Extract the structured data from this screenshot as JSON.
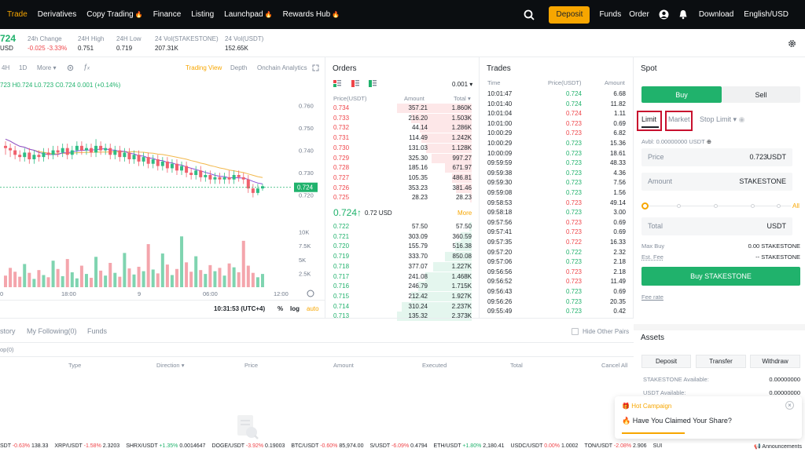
{
  "nav": {
    "items": [
      "Trade",
      "Derivatives",
      "Copy Trading",
      "Finance",
      "Listing",
      "Launchpad",
      "Rewards Hub"
    ],
    "deposit": "Deposit",
    "funds": "Funds",
    "order": "Order",
    "download": "Download",
    "lang": "English/USD"
  },
  "ticker": {
    "price": "724",
    "usd": "USD",
    "change_label": "24h Change",
    "change_value": "-0.025 -3.33%",
    "high_label": "24H High",
    "high_value": "0.751",
    "low_label": "24H Low",
    "low_value": "0.719",
    "vol1_label": "24 Vol(STAKESTONE)",
    "vol1_value": "207.31K",
    "vol2_label": "24 Vol(USDT)",
    "vol2_value": "152.65K"
  },
  "chart": {
    "intervals": [
      "4H",
      "1D",
      "More"
    ],
    "views": [
      "Trading View",
      "Depth",
      "Onchain Analytics"
    ],
    "ohlc": "723 H0.724 L0.723 C0.724 0.001 (+0.14%)",
    "y_ticks": [
      "0.760",
      "0.750",
      "0.740",
      "0.730",
      "0.720"
    ],
    "current_price_tag": "0.724",
    "vol_ticks": [
      "10K",
      "7.5K",
      "5K",
      "2.5K"
    ],
    "x_ticks": [
      "0",
      "18:00",
      "9",
      "06:00",
      "12:00"
    ],
    "time": "10:31:53 (UTC+4)",
    "percent": "%",
    "log": "log",
    "auto": "auto",
    "candles": [
      {
        "o": 0.742,
        "c": 0.741,
        "h": 0.744,
        "l": 0.738
      },
      {
        "o": 0.741,
        "c": 0.74,
        "h": 0.743,
        "l": 0.737
      },
      {
        "o": 0.74,
        "c": 0.738,
        "h": 0.742,
        "l": 0.736
      },
      {
        "o": 0.738,
        "c": 0.737,
        "h": 0.74,
        "l": 0.735
      },
      {
        "o": 0.737,
        "c": 0.739,
        "h": 0.741,
        "l": 0.735
      },
      {
        "o": 0.739,
        "c": 0.736,
        "h": 0.741,
        "l": 0.734
      },
      {
        "o": 0.736,
        "c": 0.738,
        "h": 0.74,
        "l": 0.734
      },
      {
        "o": 0.738,
        "c": 0.737,
        "h": 0.74,
        "l": 0.735
      },
      {
        "o": 0.737,
        "c": 0.739,
        "h": 0.741,
        "l": 0.735
      },
      {
        "o": 0.739,
        "c": 0.738,
        "h": 0.741,
        "l": 0.736
      },
      {
        "o": 0.738,
        "c": 0.74,
        "h": 0.742,
        "l": 0.736
      },
      {
        "o": 0.74,
        "c": 0.739,
        "h": 0.742,
        "l": 0.737
      },
      {
        "o": 0.739,
        "c": 0.741,
        "h": 0.743,
        "l": 0.737
      },
      {
        "o": 0.741,
        "c": 0.738,
        "h": 0.743,
        "l": 0.736
      },
      {
        "o": 0.738,
        "c": 0.74,
        "h": 0.742,
        "l": 0.736
      },
      {
        "o": 0.74,
        "c": 0.742,
        "h": 0.744,
        "l": 0.738
      },
      {
        "o": 0.742,
        "c": 0.74,
        "h": 0.744,
        "l": 0.738
      },
      {
        "o": 0.74,
        "c": 0.741,
        "h": 0.743,
        "l": 0.738
      },
      {
        "o": 0.741,
        "c": 0.739,
        "h": 0.743,
        "l": 0.737
      },
      {
        "o": 0.739,
        "c": 0.742,
        "h": 0.745,
        "l": 0.737
      },
      {
        "o": 0.742,
        "c": 0.74,
        "h": 0.744,
        "l": 0.738
      },
      {
        "o": 0.74,
        "c": 0.741,
        "h": 0.743,
        "l": 0.738
      },
      {
        "o": 0.741,
        "c": 0.738,
        "h": 0.743,
        "l": 0.736
      },
      {
        "o": 0.738,
        "c": 0.74,
        "h": 0.742,
        "l": 0.736
      },
      {
        "o": 0.74,
        "c": 0.737,
        "h": 0.742,
        "l": 0.735
      },
      {
        "o": 0.737,
        "c": 0.739,
        "h": 0.741,
        "l": 0.735
      },
      {
        "o": 0.739,
        "c": 0.736,
        "h": 0.741,
        "l": 0.734
      },
      {
        "o": 0.736,
        "c": 0.738,
        "h": 0.74,
        "l": 0.734
      },
      {
        "o": 0.738,
        "c": 0.735,
        "h": 0.74,
        "l": 0.733
      },
      {
        "o": 0.735,
        "c": 0.737,
        "h": 0.739,
        "l": 0.733
      },
      {
        "o": 0.737,
        "c": 0.734,
        "h": 0.739,
        "l": 0.732
      },
      {
        "o": 0.734,
        "c": 0.736,
        "h": 0.738,
        "l": 0.732
      },
      {
        "o": 0.736,
        "c": 0.733,
        "h": 0.738,
        "l": 0.731
      },
      {
        "o": 0.733,
        "c": 0.735,
        "h": 0.737,
        "l": 0.731
      },
      {
        "o": 0.735,
        "c": 0.732,
        "h": 0.737,
        "l": 0.73
      },
      {
        "o": 0.732,
        "c": 0.734,
        "h": 0.736,
        "l": 0.73
      },
      {
        "o": 0.734,
        "c": 0.731,
        "h": 0.736,
        "l": 0.729
      },
      {
        "o": 0.731,
        "c": 0.733,
        "h": 0.735,
        "l": 0.729
      },
      {
        "o": 0.733,
        "c": 0.73,
        "h": 0.735,
        "l": 0.728
      },
      {
        "o": 0.73,
        "c": 0.729,
        "h": 0.732,
        "l": 0.727
      },
      {
        "o": 0.729,
        "c": 0.731,
        "h": 0.733,
        "l": 0.727
      },
      {
        "o": 0.731,
        "c": 0.728,
        "h": 0.733,
        "l": 0.726
      },
      {
        "o": 0.728,
        "c": 0.729,
        "h": 0.731,
        "l": 0.726
      },
      {
        "o": 0.729,
        "c": 0.727,
        "h": 0.731,
        "l": 0.725
      },
      {
        "o": 0.727,
        "c": 0.728,
        "h": 0.73,
        "l": 0.725
      },
      {
        "o": 0.728,
        "c": 0.727,
        "h": 0.73,
        "l": 0.725
      },
      {
        "o": 0.727,
        "c": 0.728,
        "h": 0.73,
        "l": 0.725
      },
      {
        "o": 0.728,
        "c": 0.727,
        "h": 0.731,
        "l": 0.725
      },
      {
        "o": 0.727,
        "c": 0.729,
        "h": 0.731,
        "l": 0.725
      },
      {
        "o": 0.729,
        "c": 0.728,
        "h": 0.731,
        "l": 0.726
      },
      {
        "o": 0.728,
        "c": 0.727,
        "h": 0.73,
        "l": 0.725
      },
      {
        "o": 0.727,
        "c": 0.723,
        "h": 0.729,
        "l": 0.721
      },
      {
        "o": 0.723,
        "c": 0.721,
        "h": 0.725,
        "l": 0.719
      },
      {
        "o": 0.721,
        "c": 0.723,
        "h": 0.725,
        "l": 0.72
      },
      {
        "o": 0.723,
        "c": 0.724,
        "h": 0.725,
        "l": 0.722
      }
    ],
    "volumes": [
      2.1,
      3.5,
      2.8,
      1.9,
      4.2,
      2.6,
      1.5,
      3.1,
      2.2,
      1.8,
      4.8,
      3.3,
      2.0,
      5.1,
      2.7,
      1.6,
      3.9,
      2.4,
      1.7,
      5.5,
      3.0,
      2.1,
      4.4,
      2.6,
      1.9,
      6.2,
      3.4,
      2.3,
      3.7,
      2.9,
      7.8,
      3.2,
      2.5,
      6.1,
      4.1,
      2.2,
      3.3,
      9.2,
      4.5,
      2.8,
      5.6,
      3.1,
      2.4,
      4.0,
      2.9,
      3.5,
      2.1,
      4.3,
      3.6,
      2.7,
      8.4,
      3.9,
      2.6,
      1.8,
      2.4
    ]
  },
  "orders": {
    "title": "Orders",
    "tick_size": "0.001",
    "headers": [
      "Price(USDT)",
      "Amount",
      "Total"
    ],
    "asks": [
      [
        "0.734",
        "357.21",
        "1.860K"
      ],
      [
        "0.733",
        "216.20",
        "1.503K"
      ],
      [
        "0.732",
        "44.14",
        "1.286K"
      ],
      [
        "0.731",
        "114.49",
        "1.242K"
      ],
      [
        "0.730",
        "131.03",
        "1.128K"
      ],
      [
        "0.729",
        "325.30",
        "997.27"
      ],
      [
        "0.728",
        "185.16",
        "671.97"
      ],
      [
        "0.727",
        "105.35",
        "486.81"
      ],
      [
        "0.726",
        "353.23",
        "381.46"
      ],
      [
        "0.725",
        "28.23",
        "28.23"
      ]
    ],
    "ask_depth": [
      1.0,
      0.81,
      0.69,
      0.67,
      0.61,
      0.54,
      0.36,
      0.26,
      0.21,
      0.02
    ],
    "mid_price": "0.724",
    "mid_arrow": "↑",
    "mid_usd": "0.72 USD",
    "more": "More",
    "bids": [
      [
        "0.722",
        "57.50",
        "57.50"
      ],
      [
        "0.721",
        "303.09",
        "360.59"
      ],
      [
        "0.720",
        "155.79",
        "516.38"
      ],
      [
        "0.719",
        "333.70",
        "850.08"
      ],
      [
        "0.718",
        "377.07",
        "1.227K"
      ],
      [
        "0.717",
        "241.08",
        "1.468K"
      ],
      [
        "0.716",
        "246.79",
        "1.715K"
      ],
      [
        "0.715",
        "212.42",
        "1.927K"
      ],
      [
        "0.714",
        "310.24",
        "2.237K"
      ],
      [
        "0.713",
        "135.32",
        "2.373K"
      ]
    ],
    "bid_depth": [
      0.03,
      0.15,
      0.22,
      0.36,
      0.52,
      0.62,
      0.72,
      0.81,
      0.94,
      1.0
    ]
  },
  "trades": {
    "title": "Trades",
    "headers": [
      "Time",
      "Price(USDT)",
      "Amount"
    ],
    "rows": [
      [
        "10:01:47",
        "0.724",
        "6.68",
        "g"
      ],
      [
        "10:01:40",
        "0.724",
        "11.82",
        "g"
      ],
      [
        "10:01:04",
        "0.724",
        "1.11",
        "r"
      ],
      [
        "10:01:00",
        "0.723",
        "0.69",
        "r"
      ],
      [
        "10:00:29",
        "0.723",
        "6.82",
        "r"
      ],
      [
        "10:00:29",
        "0.723",
        "15.36",
        "g"
      ],
      [
        "10:00:09",
        "0.723",
        "18.61",
        "g"
      ],
      [
        "09:59:59",
        "0.723",
        "48.33",
        "g"
      ],
      [
        "09:59:38",
        "0.723",
        "4.36",
        "g"
      ],
      [
        "09:59:30",
        "0.723",
        "7.56",
        "g"
      ],
      [
        "09:59:08",
        "0.723",
        "1.56",
        "g"
      ],
      [
        "09:58:53",
        "0.723",
        "49.14",
        "r"
      ],
      [
        "09:58:18",
        "0.723",
        "3.00",
        "g"
      ],
      [
        "09:57:56",
        "0.723",
        "0.69",
        "r"
      ],
      [
        "09:57:41",
        "0.723",
        "0.69",
        "r"
      ],
      [
        "09:57:35",
        "0.722",
        "16.33",
        "r"
      ],
      [
        "09:57:20",
        "0.722",
        "2.32",
        "g"
      ],
      [
        "09:57:06",
        "0.723",
        "2.18",
        "g"
      ],
      [
        "09:56:56",
        "0.723",
        "2.18",
        "r"
      ],
      [
        "09:56:52",
        "0.723",
        "11.49",
        "r"
      ],
      [
        "09:56:43",
        "0.723",
        "0.69",
        "g"
      ],
      [
        "09:56:26",
        "0.723",
        "20.35",
        "g"
      ],
      [
        "09:55:49",
        "0.723",
        "0.42",
        "g"
      ]
    ]
  },
  "spot": {
    "title": "Spot",
    "buy": "Buy",
    "sell": "Sell",
    "tabs": [
      "Limit",
      "Market",
      "Stop Limit"
    ],
    "avbl": "Avbl: 0.00000000 USDT",
    "price_label": "Price",
    "price_value": "0.723",
    "price_unit": "USDT",
    "amount_label": "Amount",
    "amount_unit": "STAKESTONE",
    "slider_max": "All",
    "total_label": "Total",
    "total_unit": "USDT",
    "maxbuy_label": "Max Buy",
    "maxbuy_value": "0.00 STAKESTONE",
    "fee_label": "Est. Fee",
    "fee_value": "-- STAKESTONE",
    "buy_button": "Buy STAKESTONE",
    "fee_rate": "Fee rate"
  },
  "assets": {
    "title": "Assets",
    "buttons": [
      "Deposit",
      "Transfer",
      "Withdraw"
    ],
    "lines": [
      [
        "STAKESTONE Available:",
        "0.00000000"
      ],
      [
        "USDT Available:",
        "0.00000000"
      ]
    ]
  },
  "campaign": {
    "title": "Hot Campaign",
    "text": "Have You Claimed Your Share?"
  },
  "bottom": {
    "tabs": [
      "story",
      "My Following(0)",
      "Funds"
    ],
    "hide_pairs": "Hide Other Pairs",
    "filter": "op(0)",
    "columns": [
      "Type",
      "Direction",
      "Price",
      "Amount",
      "Executed",
      "Total",
      "Cancel All"
    ]
  },
  "bottom_ticker": [
    [
      "SDT",
      "-0.63%",
      "138.33",
      "r"
    ],
    [
      "XRP/USDT",
      "-1.58%",
      "2.3203",
      "r"
    ],
    [
      "SHRX/USDT",
      "+1.35%",
      "0.0014647",
      "g"
    ],
    [
      "DOGE/USDT",
      "-3.92%",
      "0.19003",
      "r"
    ],
    [
      "BTC/USDT",
      "-0.60%",
      "85,974.00",
      "r"
    ],
    [
      "S/USDT",
      "-6.09%",
      "0.4794",
      "r"
    ],
    [
      "ETH/USDT",
      "+1.80%",
      "2,180.41",
      "g"
    ],
    [
      "USDC/USDT",
      "0.00%",
      "1.0002",
      "r"
    ],
    [
      "TON/USDT",
      "-2.08%",
      "2.906",
      "r"
    ],
    [
      "SUI",
      "",
      " ",
      "r"
    ]
  ],
  "announcements": "Announcements",
  "colors": {
    "green": "#20b26c",
    "red": "#ef454a",
    "accent": "#f7a600",
    "navbg": "#0b0e11"
  }
}
